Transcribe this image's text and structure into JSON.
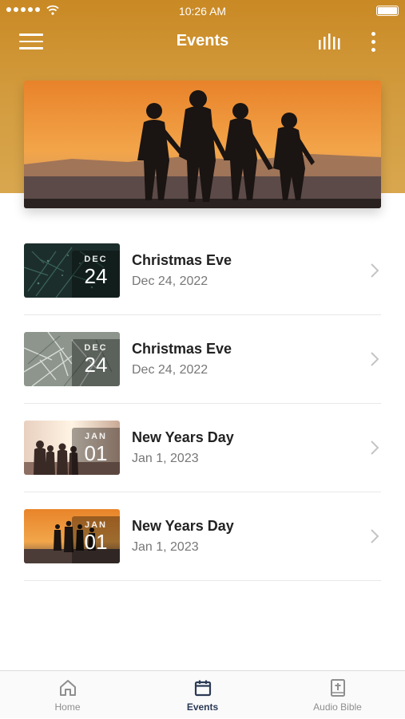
{
  "status_bar": {
    "time": "10:26 AM"
  },
  "header": {
    "title": "Events"
  },
  "icons": {
    "menu": "hamburger-menu-icon",
    "audio": "audio-bars-icon",
    "more": "vertical-ellipsis-icon",
    "chevron": "chevron-right-icon"
  },
  "colors": {
    "header_gradient_top": "#c98924",
    "header_gradient_bottom": "#d9a74f",
    "active_tab": "#2b3a55",
    "inactive_tab": "#8e8e8e"
  },
  "events": [
    {
      "month": "DEC",
      "day": "24",
      "title": "Christmas Eve",
      "date": "Dec 24, 2022"
    },
    {
      "month": "DEC",
      "day": "24",
      "title": "Christmas Eve",
      "date": "Dec 24, 2022"
    },
    {
      "month": "JAN",
      "day": "01",
      "title": "New Years Day",
      "date": "Jan 1, 2023"
    },
    {
      "month": "JAN",
      "day": "01",
      "title": "New Years Day",
      "date": "Jan 1, 2023"
    }
  ],
  "tab_bar": {
    "active": "Events",
    "tabs": [
      {
        "label": "Home",
        "icon": "home-icon"
      },
      {
        "label": "Events",
        "icon": "calendar-icon"
      },
      {
        "label": "Audio Bible",
        "icon": "bible-icon"
      }
    ]
  }
}
